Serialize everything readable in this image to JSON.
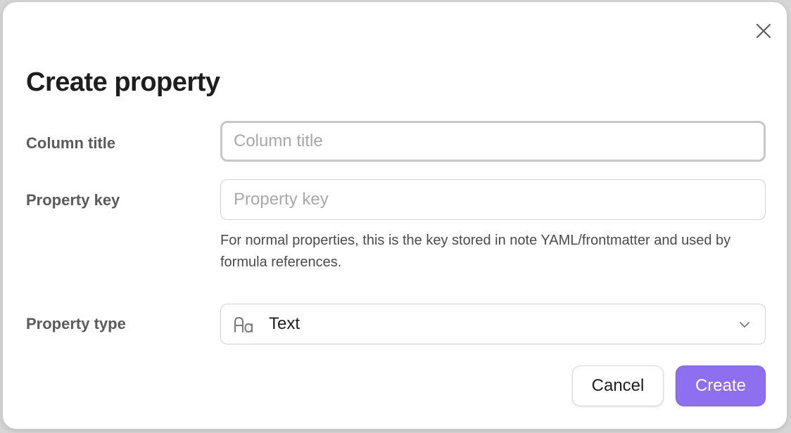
{
  "dialog": {
    "title": "Create property",
    "close_icon": "close-icon"
  },
  "form": {
    "column_title": {
      "label": "Column title",
      "value": "",
      "placeholder": "Column title"
    },
    "property_key": {
      "label": "Property key",
      "value": "",
      "placeholder": "Property key",
      "help": "For normal properties, this is the key stored in note YAML/frontmatter and used by formula references."
    },
    "property_type": {
      "label": "Property type",
      "selected": "Text",
      "icon": "text-type-icon"
    }
  },
  "actions": {
    "cancel_label": "Cancel",
    "create_label": "Create"
  },
  "colors": {
    "accent": "#8e6ff0",
    "text_primary": "#1e1e1e",
    "text_label": "#5b5b5b",
    "border": "#d3d3d3"
  }
}
